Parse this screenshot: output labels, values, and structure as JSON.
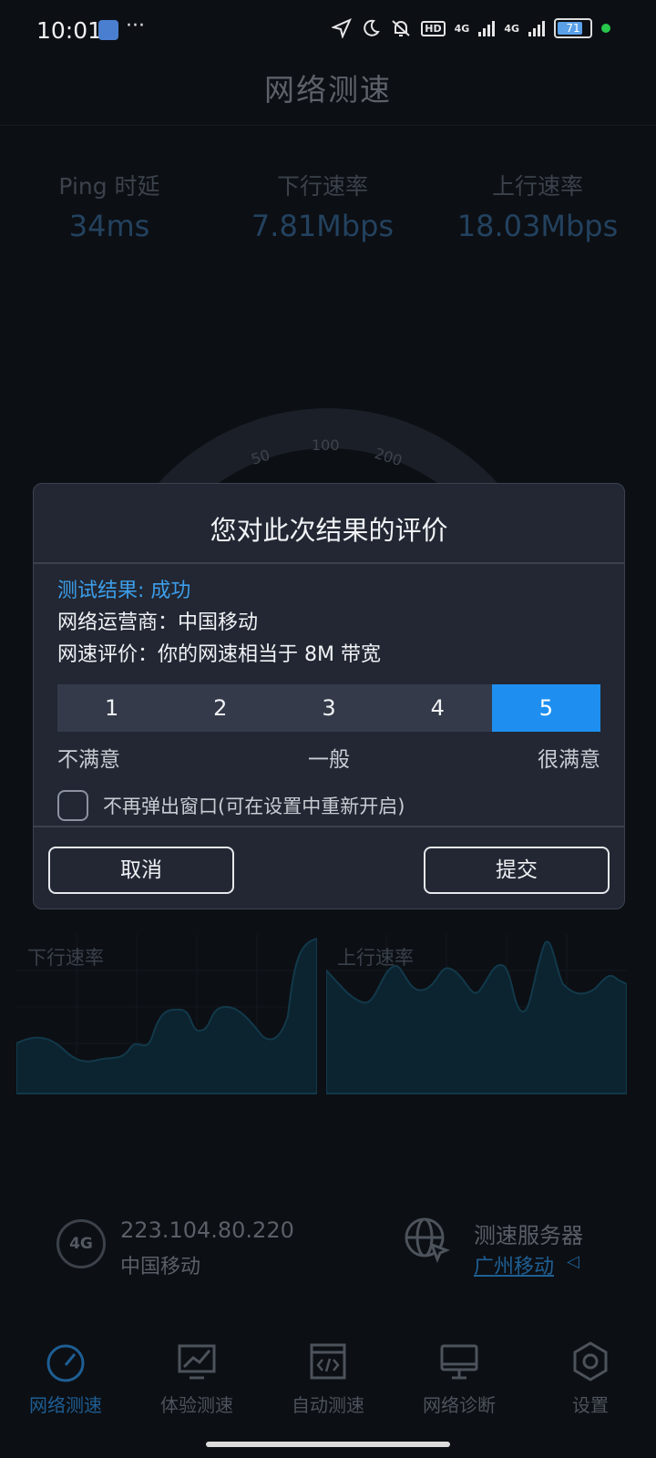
{
  "status_bar": {
    "time": "10:01",
    "more": "···",
    "network_1": "4G",
    "network_2": "4G",
    "battery": "71"
  },
  "header": {
    "title": "网络测速"
  },
  "stats": [
    {
      "label": "Ping 时延",
      "value": "34ms"
    },
    {
      "label": "下行速率",
      "value": "7.81Mbps"
    },
    {
      "label": "上行速率",
      "value": "18.03Mbps"
    }
  ],
  "gauge": {
    "ticks": [
      "50",
      "100",
      "200"
    ]
  },
  "charts": {
    "download_label": "下行速率",
    "upload_label": "上行速率"
  },
  "connection": {
    "badge": "4G",
    "ip": "223.104.80.220",
    "carrier": "中国移动",
    "server_label": "测速服务器",
    "server_value": "广州移动"
  },
  "nav": {
    "items": [
      {
        "label": "网络测速",
        "icon": "speedometer-icon",
        "active": true
      },
      {
        "label": "体验测速",
        "icon": "monitor-chart-icon",
        "active": false
      },
      {
        "label": "自动测速",
        "icon": "code-window-icon",
        "active": false
      },
      {
        "label": "网络诊断",
        "icon": "desktop-icon",
        "active": false
      },
      {
        "label": "设置",
        "icon": "settings-hex-icon",
        "active": false
      }
    ]
  },
  "dialog": {
    "title": "您对此次结果的评价",
    "result": "测试结果: 成功",
    "operator": "网络运营商：中国移动",
    "evaluation": "网速评价：你的网速相当于 8M 带宽",
    "ratings": [
      "1",
      "2",
      "3",
      "4",
      "5"
    ],
    "selected_rating": "5",
    "scale_low": "不满意",
    "scale_mid": "一般",
    "scale_high": "很满意",
    "checkbox_label": "不再弹出窗口(可在设置中重新开启)",
    "checkbox_checked": false,
    "cancel": "取消",
    "submit": "提交"
  },
  "colors": {
    "accent": "#1e8ff0",
    "result_blue": "#3c9eea",
    "background": "#0c0f14",
    "dialog_bg": "#222733"
  }
}
